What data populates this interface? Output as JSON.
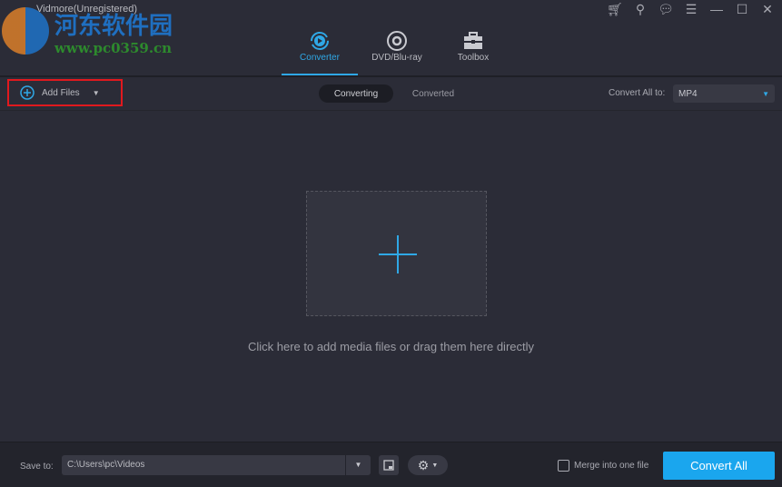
{
  "window": {
    "title": "Vidmore(Unregistered)"
  },
  "watermark": {
    "name": "河东软件园",
    "url": "www.pc0359.cn"
  },
  "tabs": [
    {
      "label": "Converter",
      "icon": "converter-icon",
      "active": true
    },
    {
      "label": "DVD/Blu-ray",
      "icon": "disc-icon"
    },
    {
      "label": "Toolbox",
      "icon": "toolbox-icon"
    }
  ],
  "toolbar": {
    "add_files": "Add Files",
    "segments": [
      "Converting",
      "Converted"
    ],
    "convert_all_to_label": "Convert All to:",
    "format": "MP4"
  },
  "main": {
    "hint": "Click here to add media files or drag them here directly"
  },
  "footer": {
    "save_to_label": "Save to:",
    "path": "C:\\Users\\pc\\Videos",
    "merge_label": "Merge into one file",
    "merge_checked": false,
    "convert_all": "Convert All"
  },
  "colors": {
    "accent": "#1aa6ee",
    "highlight": "#e0191e"
  }
}
